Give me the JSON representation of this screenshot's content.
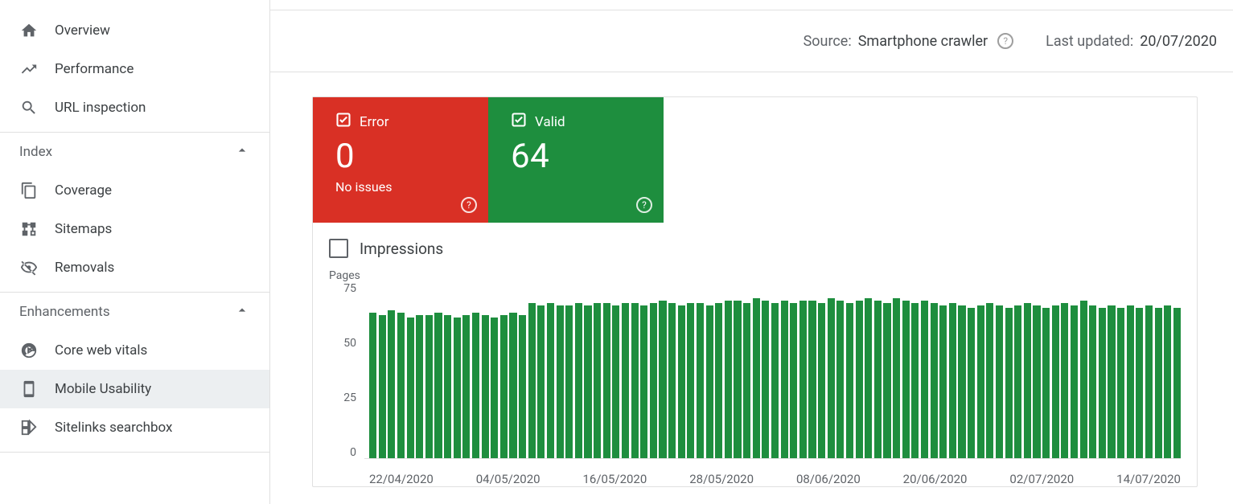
{
  "sidebar": {
    "items": [
      {
        "label": "Overview",
        "icon": "home"
      },
      {
        "label": "Performance",
        "icon": "trend"
      },
      {
        "label": "URL inspection",
        "icon": "search"
      }
    ],
    "sections": [
      {
        "title": "Index",
        "items": [
          {
            "label": "Coverage",
            "icon": "copy"
          },
          {
            "label": "Sitemaps",
            "icon": "sitemap"
          },
          {
            "label": "Removals",
            "icon": "eye-off"
          }
        ]
      },
      {
        "title": "Enhancements",
        "items": [
          {
            "label": "Core web vitals",
            "icon": "speed"
          },
          {
            "label": "Mobile Usability",
            "icon": "mobile",
            "selected": true
          },
          {
            "label": "Sitelinks searchbox",
            "icon": "box"
          }
        ]
      }
    ]
  },
  "topbar": {
    "source_label": "Source:",
    "source_value": "Smartphone crawler",
    "updated_label": "Last updated:",
    "updated_value": "20/07/2020"
  },
  "stats": {
    "error": {
      "label": "Error",
      "count": "0",
      "sub": "No issues"
    },
    "valid": {
      "label": "Valid",
      "count": "64",
      "sub": ""
    }
  },
  "impressions_label": "Impressions",
  "chart_data": {
    "type": "bar",
    "title": "",
    "ylabel": "Pages",
    "xlabel": "",
    "ylim": [
      0,
      75
    ],
    "yticks": [
      75,
      50,
      25,
      0
    ],
    "categories": [
      "22/04/2020",
      "04/05/2020",
      "16/05/2020",
      "28/05/2020",
      "08/06/2020",
      "20/06/2020",
      "02/07/2020",
      "14/07/2020"
    ],
    "values": [
      62,
      61,
      63,
      62,
      60,
      61,
      61,
      62,
      61,
      60,
      61,
      62,
      61,
      60,
      61,
      62,
      61,
      66,
      65,
      66,
      65,
      65,
      66,
      65,
      66,
      66,
      65,
      66,
      66,
      65,
      66,
      67,
      66,
      65,
      66,
      66,
      65,
      66,
      67,
      67,
      66,
      68,
      67,
      66,
      67,
      66,
      67,
      67,
      66,
      68,
      67,
      66,
      67,
      68,
      67,
      66,
      68,
      67,
      66,
      67,
      66,
      65,
      66,
      65,
      64,
      65,
      66,
      65,
      64,
      65,
      66,
      65,
      64,
      65,
      66,
      65,
      67,
      65,
      64,
      65,
      64,
      65,
      64,
      65,
      64,
      65,
      64
    ]
  }
}
